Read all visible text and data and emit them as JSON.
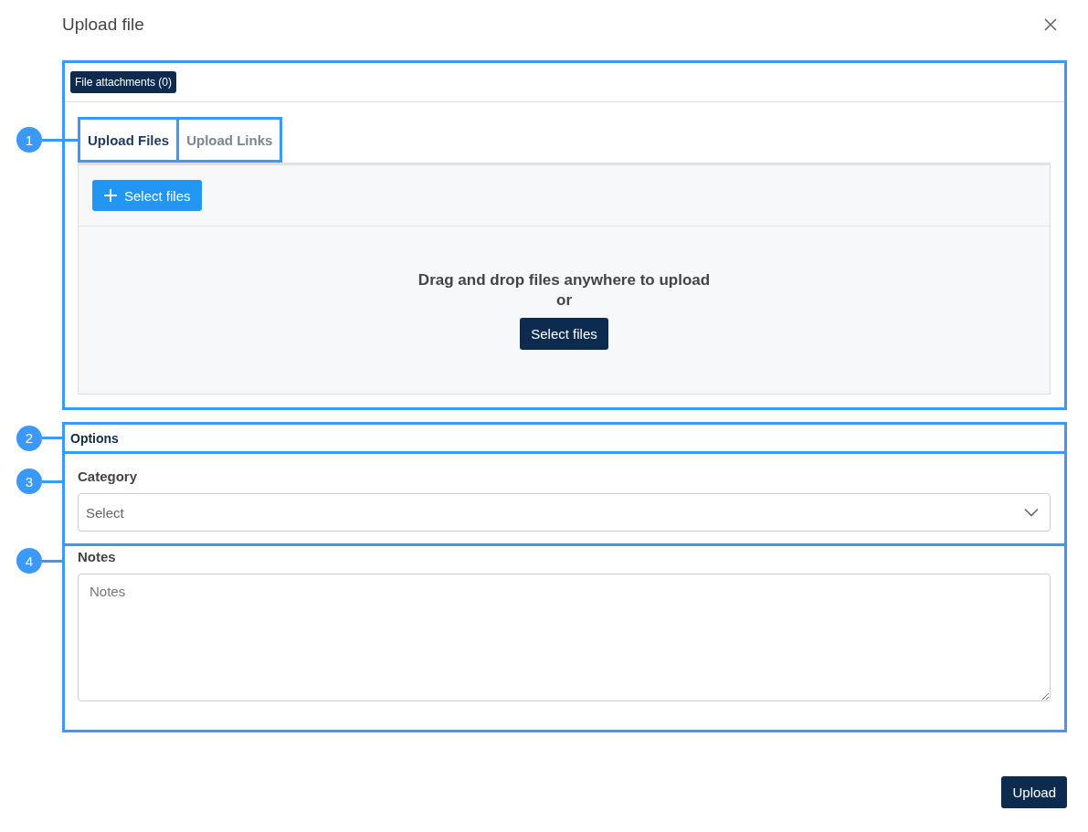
{
  "dialog": {
    "title": "Upload file"
  },
  "attachments_badge": "File attachments (0)",
  "tabs": [
    {
      "label": "Upload Files",
      "selected": true
    },
    {
      "label": "Upload Links",
      "selected": false
    }
  ],
  "upload_panel": {
    "toolbar_button": "Select files",
    "drop_text": "Drag and drop files anywhere to upload",
    "or_text": "or",
    "select_button": "Select files"
  },
  "options": {
    "title": "Options",
    "category": {
      "label": "Category",
      "placeholder": "Select"
    },
    "notes": {
      "label": "Notes",
      "placeholder": "Notes"
    }
  },
  "upload_button": "Upload",
  "callouts": [
    "1",
    "2",
    "3",
    "4"
  ]
}
